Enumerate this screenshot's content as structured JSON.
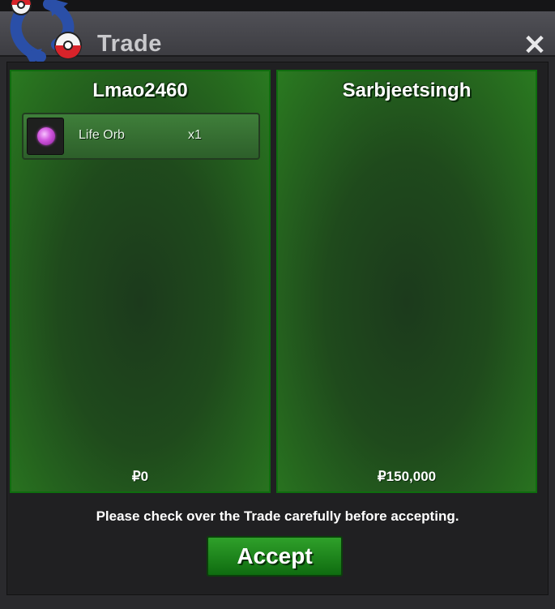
{
  "window": {
    "title": "Trade"
  },
  "icons": {
    "logo": "trade-swap-icon",
    "close": "close-icon"
  },
  "players": [
    {
      "name": "Lmao2460",
      "money": "₽0",
      "items": [
        {
          "name": "Life Orb",
          "quantity": "x1",
          "icon": "life-orb-icon"
        }
      ]
    },
    {
      "name": "Sarbjeetsingh",
      "money": "₽150,000",
      "items": []
    }
  ],
  "footer": {
    "notice": "Please check over the Trade carefully before accepting.",
    "accept_label": "Accept"
  },
  "colors": {
    "panel_green": "#1f4a1c",
    "accent_green": "#2fa02a"
  }
}
